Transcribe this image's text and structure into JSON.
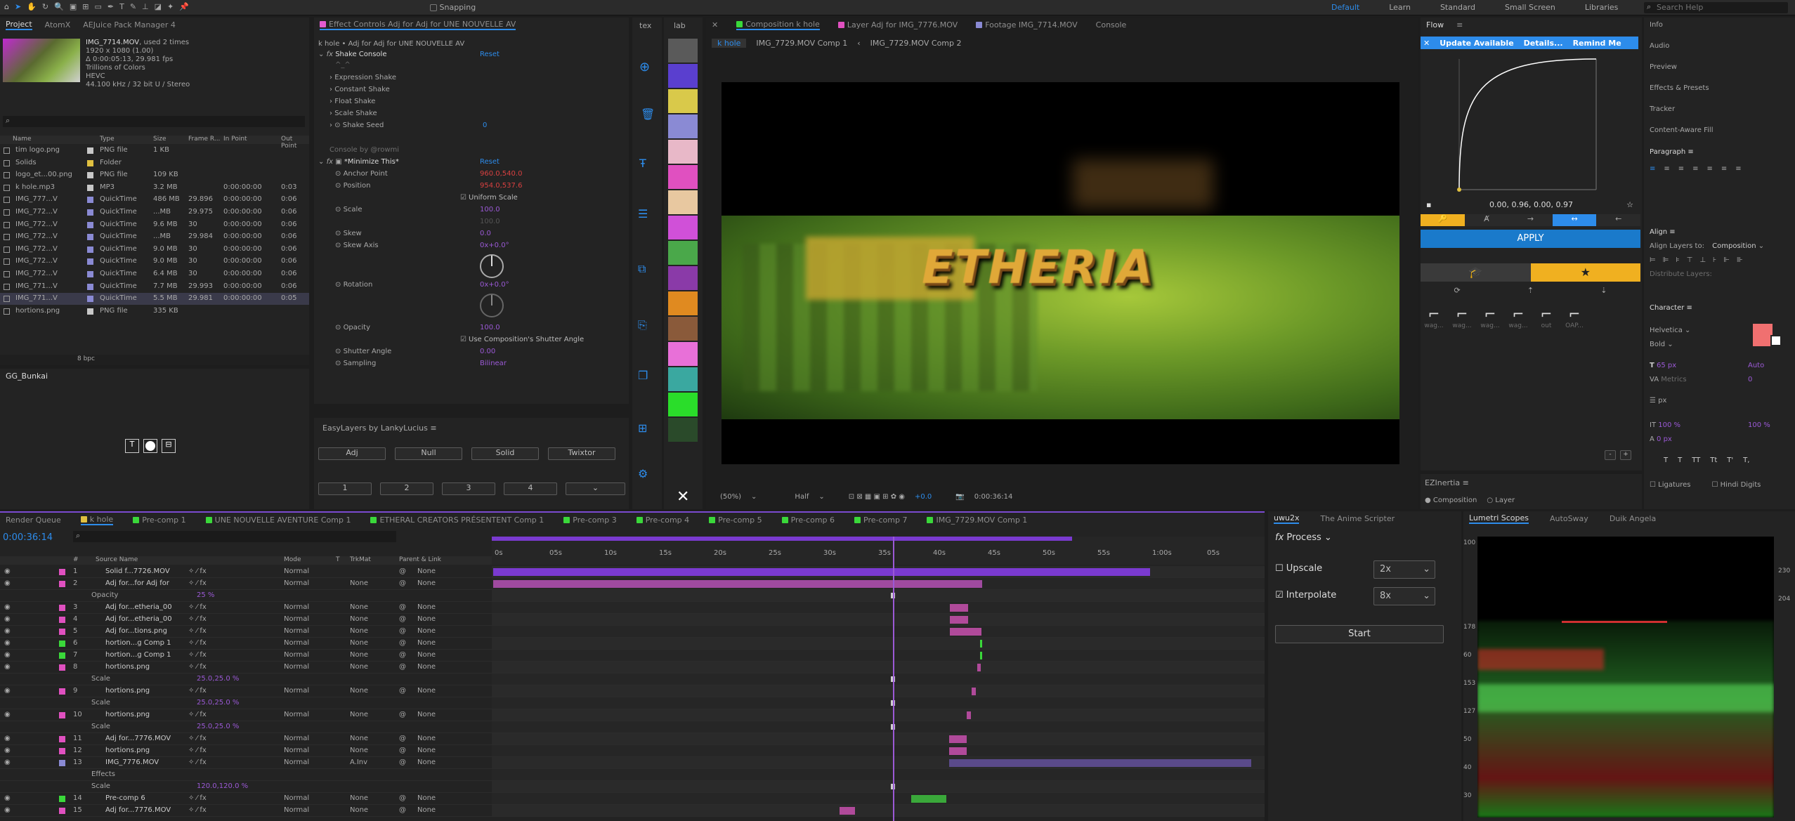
{
  "top": {
    "workspaces": [
      "Default",
      "Learn",
      "Standard",
      "Small Screen",
      "Libraries"
    ],
    "snapping": "Snapping",
    "search_placeholder": "Search Help"
  },
  "project": {
    "tabs": [
      "Project",
      "AtomX",
      "AEJuice Pack Manager 4"
    ],
    "file": "IMG_7714.MOV",
    "used": ", used 2 times",
    "size": "1920 x 1080 (1.00)",
    "dur": "Δ 0:00:05:13, 29.981 fps",
    "colors": "Trillions of Colors",
    "codec": "HEVC",
    "audio": "44.100 kHz / 32 bit U / Stereo",
    "cols": [
      "Name",
      "Type",
      "Size",
      "Frame R...",
      "In Point",
      "Out Point"
    ],
    "bpc": "8 bpc",
    "rows": [
      [
        "tim logo.png",
        "PNG file",
        "1 KB",
        "",
        "",
        ""
      ],
      [
        "Solids",
        "Folder",
        "",
        "",
        "",
        ""
      ],
      [
        "logo_et...00.png",
        "PNG file",
        "109 KB",
        "",
        "",
        ""
      ],
      [
        "k hole.mp3",
        "MP3",
        "3.2 MB",
        "",
        "0:00:00:00",
        "0:03"
      ],
      [
        "IMG_777...V",
        "QuickTime",
        "486 MB",
        "29.896",
        "0:00:00:00",
        "0:06"
      ],
      [
        "IMG_772...V",
        "QuickTime",
        "...MB",
        "29.975",
        "0:00:00:00",
        "0:06"
      ],
      [
        "IMG_772...V",
        "QuickTime",
        "9.6 MB",
        "30",
        "0:00:00:00",
        "0:06"
      ],
      [
        "IMG_772...V",
        "QuickTime",
        "...MB",
        "29.984",
        "0:00:00:00",
        "0:06"
      ],
      [
        "IMG_772...V",
        "QuickTime",
        "9.0 MB",
        "30",
        "0:00:00:00",
        "0:06"
      ],
      [
        "IMG_772...V",
        "QuickTime",
        "9.0 MB",
        "30",
        "0:00:00:00",
        "0:06"
      ],
      [
        "IMG_772...V",
        "QuickTime",
        "6.4 MB",
        "30",
        "0:00:00:00",
        "0:06"
      ],
      [
        "IMG_771...V",
        "QuickTime",
        "7.7 MB",
        "29.993",
        "0:00:00:00",
        "0:06"
      ],
      [
        "IMG_771...V",
        "QuickTime",
        "5.5 MB",
        "29.981",
        "0:00:00:00",
        "0:05"
      ],
      [
        "hortions.png",
        "PNG file",
        "335 KB",
        "",
        "",
        ""
      ]
    ]
  },
  "bunkai": {
    "title": "GG_Bunkai"
  },
  "effects": {
    "tab_prefix": "Effect Controls",
    "tab_layer": "Adj for Adj for UNE NOUVELLE AV",
    "path": "k hole • Adj for Adj for UNE NOUVELLE AV",
    "shake": "Shake Console",
    "reset": "Reset",
    "tilde": "^_^",
    "sub": [
      "Expression Shake",
      "Constant Shake",
      "Float Shake",
      "Scale Shake"
    ],
    "shake_seed": "Shake Seed",
    "seed_val": "0",
    "console_by": "Console by @rowmi",
    "minimize": "*Minimize This*",
    "props": [
      [
        "Anchor Point",
        "960.0,540.0"
      ],
      [
        "Position",
        "954.0,537.6"
      ],
      [
        "",
        "Uniform Scale"
      ],
      [
        "Scale",
        "100.0"
      ],
      [
        "",
        "100.0"
      ],
      [
        "Skew",
        "0.0"
      ],
      [
        "Skew Axis",
        "0x+0.0°"
      ],
      [
        "Rotation",
        "0x+0.0°"
      ],
      [
        "Opacity",
        "100.0"
      ],
      [
        "",
        "Use Composition's Shutter Angle"
      ],
      [
        "Shutter Angle",
        "0.00"
      ],
      [
        "Sampling",
        "Bilinear"
      ]
    ]
  },
  "easy": {
    "title": "EasyLayers by LankyLucius",
    "btns": [
      "Adj",
      "Null",
      "Solid",
      "Twixtor"
    ],
    "nums": [
      "1",
      "2",
      "3",
      "4"
    ]
  },
  "lab": {
    "tabs": [
      "tex",
      "lab"
    ]
  },
  "comp": {
    "tabs": [
      "Composition",
      "k hole",
      "Layer Adj for IMG_7776.MOV",
      "Footage IMG_7714.MOV",
      "Console"
    ],
    "crumbs": [
      "k hole",
      "IMG_7729.MOV Comp 1",
      "IMG_7729.MOV Comp 2"
    ],
    "title_text": "ETHERIA",
    "zoom": "(50%)",
    "res": "Half",
    "exposure": "+0.0",
    "time": "0:00:36:14"
  },
  "flow": {
    "title": "Flow",
    "update": "Update Available",
    "details": "Details...",
    "remind": "Remind Me",
    "vals": "0.00, 0.96, 0.00, 0.97",
    "apply": "APPLY",
    "presets": [
      "wag...",
      "wag...",
      "wag...",
      "wag...",
      "out",
      "OAP..."
    ]
  },
  "ezin": {
    "title": "EZInertia",
    "opts": [
      "Composition",
      "Layer"
    ]
  },
  "right": {
    "items": [
      "Info",
      "Audio",
      "Preview",
      "Effects & Presets",
      "Tracker",
      "Content-Aware Fill"
    ],
    "paragraph": "Paragraph",
    "align": "Align",
    "align_to": "Align Layers to:",
    "align_val": "Composition",
    "distribute": "Distribute Layers:",
    "character": "Character",
    "font": "Helvetica",
    "weight": "Bold",
    "size": "65 px",
    "auto": "Auto",
    "metrics": "Metrics",
    "track": "0",
    "leading": "px",
    "v100": "100 %",
    "h100": "100 %",
    "px0": "0 px",
    "ligatures": "Ligatures",
    "hindi": "Hindi Digits",
    "styles": [
      "T",
      "T",
      "TT",
      "Tt",
      "T'",
      "T,"
    ]
  },
  "timeline": {
    "queue": "Render Queue",
    "tabs": [
      "k hole",
      "Pre-comp 1",
      "UNE NOUVELLE AVENTURE Comp 1",
      "ETHERAL CREATORS PRÉSENTENT Comp 1",
      "Pre-comp 3",
      "Pre-comp 4",
      "Pre-comp 5",
      "Pre-comp 6",
      "Pre-comp 7",
      "IMG_7729.MOV Comp 1"
    ],
    "time": "0:00:36:14",
    "cols": [
      "#",
      "Source Name",
      "Mode",
      "T",
      "TrkMat",
      "Parent & Link"
    ],
    "ruler": [
      "0s",
      "05s",
      "10s",
      "15s",
      "20s",
      "25s",
      "30s",
      "35s",
      "40s",
      "45s",
      "50s",
      "55s",
      "1:00s",
      "05s"
    ],
    "layers": [
      [
        "1",
        "Solid f...7726.MOV",
        "Normal",
        "",
        "None"
      ],
      [
        "2",
        "Adj for...for Adj for",
        "Normal",
        "None",
        "None"
      ],
      [
        "",
        "Opacity",
        "25 %",
        "",
        ""
      ],
      [
        "3",
        "Adj for...etheria_00",
        "Normal",
        "None",
        "None"
      ],
      [
        "4",
        "Adj for...etheria_00",
        "Normal",
        "None",
        "None"
      ],
      [
        "5",
        "Adj for...tions.png",
        "Normal",
        "None",
        "None"
      ],
      [
        "6",
        "hortion...g Comp 1",
        "Normal",
        "None",
        "None"
      ],
      [
        "7",
        "hortion...g Comp 1",
        "Normal",
        "None",
        "None"
      ],
      [
        "8",
        "hortions.png",
        "Normal",
        "None",
        "None"
      ],
      [
        "",
        "Scale",
        "25.0,25.0 %",
        "",
        ""
      ],
      [
        "9",
        "hortions.png",
        "Normal",
        "None",
        "None"
      ],
      [
        "",
        "Scale",
        "25.0,25.0 %",
        "",
        ""
      ],
      [
        "10",
        "hortions.png",
        "Normal",
        "None",
        "None"
      ],
      [
        "",
        "Scale",
        "25.0,25.0 %",
        "",
        ""
      ],
      [
        "11",
        "Adj for...7776.MOV",
        "Normal",
        "None",
        "None"
      ],
      [
        "12",
        "hortions.png",
        "Normal",
        "None",
        "None"
      ],
      [
        "13",
        "IMG_7776.MOV",
        "Normal",
        "A.Inv",
        "None"
      ],
      [
        "",
        "Effects",
        "",
        "",
        ""
      ],
      [
        "",
        "Scale",
        "120.0,120.0 %",
        "",
        ""
      ],
      [
        "14",
        "Pre-comp 6",
        "Normal",
        "None",
        "None"
      ],
      [
        "15",
        "Adj for...7776.MOV",
        "Normal",
        "None",
        "None"
      ]
    ]
  },
  "uwu": {
    "tabs": [
      "uwu2x",
      "The Anime Scripter"
    ],
    "process": "Process",
    "upscale": "Upscale",
    "up_val": "2x",
    "interp": "Interpolate",
    "int_val": "8x",
    "start": "Start"
  },
  "lumetri": {
    "tabs": [
      "Lumetri Scopes",
      "AutoSway",
      "Duik Angela"
    ],
    "scale": [
      "100",
      "230",
      "204",
      "178",
      "60",
      "153",
      "127",
      "50",
      "40",
      "30"
    ]
  }
}
